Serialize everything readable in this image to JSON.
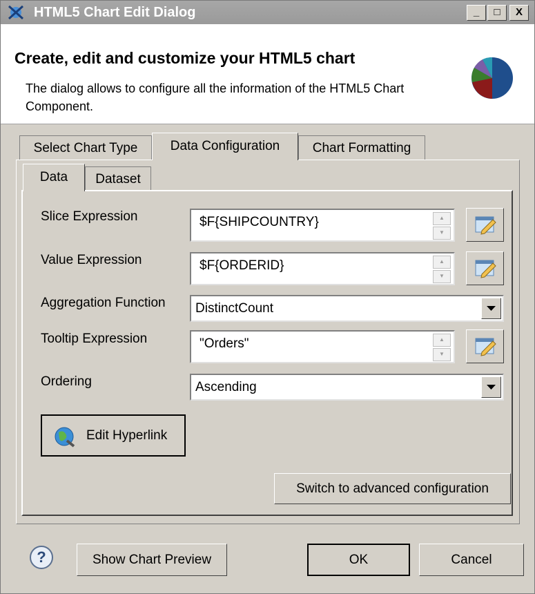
{
  "window": {
    "title": "HTML5 Chart Edit Dialog",
    "controls": {
      "minimize": "_",
      "maximize": "□",
      "close": "X"
    }
  },
  "header": {
    "title": "Create, edit and customize your HTML5 chart",
    "description": "The dialog allows to configure all the information of the HTML5 Chart Component.",
    "icon": "pie-chart-icon"
  },
  "tabs": [
    {
      "label": "Select Chart Type",
      "active": false
    },
    {
      "label": "Data Configuration",
      "active": true
    },
    {
      "label": "Chart Formatting",
      "active": false
    }
  ],
  "subtabs": [
    {
      "label": "Data",
      "active": true
    },
    {
      "label": "Dataset",
      "active": false
    }
  ],
  "form": {
    "slice": {
      "label": "Slice Expression",
      "value": "$F{SHIPCOUNTRY}"
    },
    "value": {
      "label": "Value Expression",
      "value": "$F{ORDERID}"
    },
    "aggregation": {
      "label": "Aggregation Function",
      "value": "DistinctCount"
    },
    "tooltip": {
      "label": "Tooltip Expression",
      "value": "\"Orders\""
    },
    "ordering": {
      "label": "Ordering",
      "value": "Ascending"
    }
  },
  "buttons": {
    "edit_hyperlink": "Edit Hyperlink",
    "advanced": "Switch to advanced configuration",
    "help": "?",
    "preview": "Show Chart Preview",
    "ok": "OK",
    "cancel": "Cancel"
  },
  "colors": {
    "titlebar": "#9f9f9f",
    "pie": [
      "#1f4e8c",
      "#8b1a1a",
      "#3a7d2c",
      "#7b5ea7",
      "#2a9bb3"
    ]
  }
}
